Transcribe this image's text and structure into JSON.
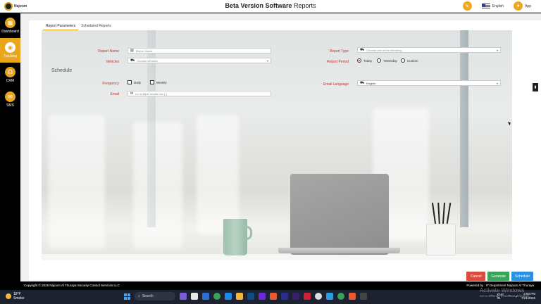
{
  "brand": {
    "logo_text": "Najoom"
  },
  "header": {
    "title_bold": "Beta Version Software",
    "title_rest": " Reports"
  },
  "top_right": {
    "language": "English",
    "app": "App"
  },
  "sidebar": {
    "items": [
      {
        "label": "Dashboard",
        "icon": "dashboard-icon",
        "glyph": "▦"
      },
      {
        "label": "Tracking",
        "icon": "location-pin-icon",
        "glyph": "◉",
        "active": true
      },
      {
        "label": "CRM",
        "icon": "headset-icon",
        "glyph": "☊"
      },
      {
        "label": "SMS",
        "icon": "message-icon",
        "glyph": "✉"
      }
    ]
  },
  "tabs": [
    "Report Parameters",
    "Scheduled Reports"
  ],
  "form": {
    "report_name_label": "Report Name",
    "report_name_placeholder": "Report Name",
    "vehicles_label": "Vehicles",
    "vehicles_placeholder": "Choose vehicles",
    "report_type_label": "Report Type",
    "report_type_placeholder": "Choose one of the following...",
    "report_period_label": "Report Period",
    "period_options": [
      "Today",
      "Yesterday",
      "Custom"
    ],
    "period_selected": "Today",
    "schedule_title": "Schedule",
    "frequency_label": "Frequency",
    "frequency_options": [
      "Daily",
      "Weekly"
    ],
    "email_label": "Email",
    "email_placeholder": "for multiple emails use (,)",
    "email_language_label": "Email Language",
    "email_language_value": "English"
  },
  "buttons": {
    "cancel": "Cancel",
    "generate": "Generate",
    "schedule": "Schedule"
  },
  "footer": {
    "copyright": "Copyright © 2025 Najoom Al Thuraya Security Control Services LLC",
    "powered": "Powered by :  IT Department Najoom Al Thuraya"
  },
  "taskbar": {
    "weather_temp": "18°F",
    "weather_text": "Smoke",
    "search": "Search",
    "lang": "ENG",
    "lang_sub": "IN",
    "time": "2:50 PM",
    "date": "7/21/2025"
  },
  "watermark": {
    "title": "Activate Windows",
    "sub": "Go to Settings to activate Windows."
  },
  "colors": {
    "accent": "#e9a51c",
    "cancel": "#d94b3c",
    "generate": "#3aa35a",
    "schedule": "#2d8fe0"
  }
}
